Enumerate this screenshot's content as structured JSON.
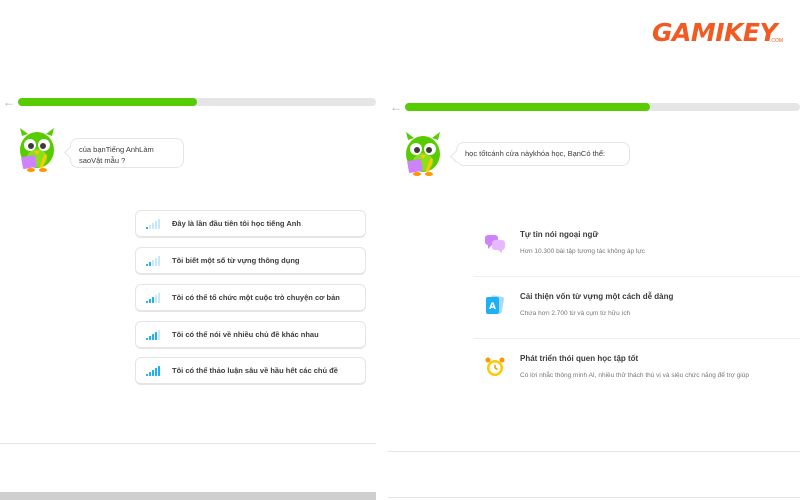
{
  "left": {
    "progress": 0.5,
    "speech": "của bạnTiếng AnhLàm saoVật mẫu ?",
    "options": [
      {
        "label": "Đây là lần đầu tiên tôi học tiếng Anh",
        "level": 1
      },
      {
        "label": "Tôi biết một số từ vựng thông dụng",
        "level": 2
      },
      {
        "label": "Tôi có thể tổ chức một cuộc trò chuyện cơ bản",
        "level": 3
      },
      {
        "label": "Tôi có thể nói về nhiều chủ đề khác nhau",
        "level": 4
      },
      {
        "label": "Tôi có thể thảo luận sâu về hầu hết các chủ đề",
        "level": 5
      }
    ]
  },
  "right": {
    "progress": 0.62,
    "speech": "học tốtcánh cửa nàykhóa học, BạnCó thể:",
    "features": [
      {
        "title": "Tự tin nói ngoại ngữ",
        "subtitle": "Hơn 10.300 bài tập tương tác không áp lực",
        "icon": "speech-bubbles-icon"
      },
      {
        "title": "Cải thiện vốn từ vựng một cách dễ dàng",
        "subtitle": "Chứa hơn 2.700 từ và cụm từ hữu ích",
        "icon": "flashcards-icon"
      },
      {
        "title": "Phát triển thói quen học tập tốt",
        "subtitle": "Có lời nhắc thông minh AI, nhiều thử thách thú vị và siêu chức năng để trợ giúp",
        "icon": "alarm-clock-icon"
      }
    ]
  },
  "logo": {
    "brand": "GAMIKEY",
    "domain": ".COM"
  },
  "colors": {
    "accent": "#58cc02",
    "level_bar": "#1cb0f6",
    "level_bar_inactive": "#c7e8fb",
    "logo": "#f15a22"
  }
}
